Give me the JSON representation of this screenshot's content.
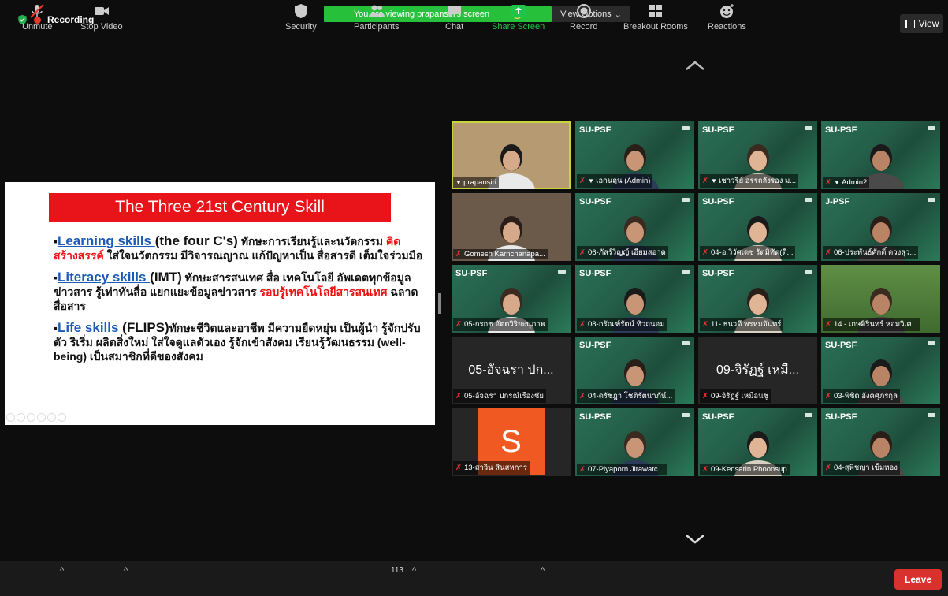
{
  "top": {
    "recording_label": "Recording",
    "share_banner": "You are viewing prapansiri's screen",
    "view_options_label": "View Options",
    "view_label": "View"
  },
  "slide": {
    "title": "The Three 21st Century Skill",
    "b1_head": "Learning skills ",
    "b1_sub": "(the four C's)",
    "b1_text1": " ทักษะการเรียนรู้และนวัตกรรม ",
    "b1_red": "คิดสร้างสรรค์",
    "b1_text2": " ใส่ใจนวัตกรรม มีวิจารณญาณ แก้ปัญหาเป็น สื่อสารดี เต็มใจร่วมมือ",
    "b2_head": "Literacy skills ",
    "b2_sub": "(IMT)",
    "b2_text1": " ทักษะสารสนเทศ สื่อ เทคโนโลยี อัพเดตทุกข้อมูลข่าวสาร รู้เท่าทันสื่อ แยกแยะข้อมูลข่าวสาร ",
    "b2_red": "รอบรู้เทคโนโลยีสารสนเทศ",
    "b2_text2": " ฉลาดสื่อสาร",
    "b3_head": "Life skills ",
    "b3_sub": "(FLIPS)",
    "b3_text": "ทักษะชีวิตและอาชีพ มีความยืดหยุ่น เป็นผู้นำ รู้จักปรับตัว ริเริ่ม ผลิตสิ่งใหม่ ใส่ใจดูแลตัวเอง รู้จักเข้าสังคม เรียนรู้วัฒนธรรม (well-being) เป็นสมาชิกที่ดีของสังคม"
  },
  "tiles": [
    {
      "org": "",
      "name": "prapansiri",
      "big": ""
    },
    {
      "org": "SU-PSF",
      "name": "เอกนฤน (Admin)",
      "big": ""
    },
    {
      "org": "SU-PSF",
      "name": "เชาวรีย์ อรรถลังรอง ม...",
      "big": ""
    },
    {
      "org": "SU-PSF",
      "name": "Admin2",
      "big": ""
    },
    {
      "org": "",
      "name": "Gomesh Karnchanapa...",
      "big": ""
    },
    {
      "org": "SU-PSF",
      "name": "06-ภัสร์วิญญ์ เอียมสอาด",
      "big": ""
    },
    {
      "org": "SU-PSF",
      "name": "04-อ.วิวัศเดช รัตมิทัต(ดี...",
      "big": ""
    },
    {
      "org": "J-PSF",
      "name": "06-ประพันธ์ศักดิ์ ดวงสุว...",
      "big": ""
    },
    {
      "org": "SU-PSF",
      "name": "05-กรกช อัตตวิริยะนุภาพ",
      "big": ""
    },
    {
      "org": "SU-PSF",
      "name": "08-กรัณฑ์รัตน์ ทิวถนอม",
      "big": ""
    },
    {
      "org": "SU-PSF",
      "name": "11- ธนวดี พรหมจันทร์",
      "big": ""
    },
    {
      "org": "",
      "name": "14 - เกษศิรินทร์ หอมวิเศ...",
      "big": ""
    },
    {
      "org": "",
      "name": "05-อัจฉรา ปกรณ์เรืองชัย",
      "big": "05-อัจฉรา ปก..."
    },
    {
      "org": "SU-PSF",
      "name": "04-ดรัชฎา โชติรัตนาภัน์...",
      "big": ""
    },
    {
      "org": "",
      "name": "09-จิรัฏฐ์ เหมือนชู",
      "big": "09-จิรัฏฐ์ เหมื..."
    },
    {
      "org": "SU-PSF",
      "name": "03-พิชิต อังคศุภรกุล",
      "big": ""
    },
    {
      "org": "",
      "name": "13-สาวิน สินสหการ",
      "big": "",
      "avatar": "S"
    },
    {
      "org": "SU-PSF",
      "name": "07-Piyaporn Jirawatc...",
      "big": ""
    },
    {
      "org": "SU-PSF",
      "name": "09-Kedsarin Phoonsup",
      "big": ""
    },
    {
      "org": "SU-PSF",
      "name": "04-สุพิชญา เข็มทอง",
      "big": ""
    }
  ],
  "toolbar": {
    "unmute": "Unmute",
    "stop_video": "Stop Video",
    "security": "Security",
    "participants": "Participants",
    "participants_count": "113",
    "chat": "Chat",
    "share_screen": "Share Screen",
    "record": "Record",
    "breakout_rooms": "Breakout Rooms",
    "reactions": "Reactions",
    "leave": "Leave"
  },
  "colors": {
    "banner_green": "#27c03a",
    "slide_title_red": "#e8141a",
    "leave_red": "#d9322e",
    "share_green": "#21c44a"
  }
}
